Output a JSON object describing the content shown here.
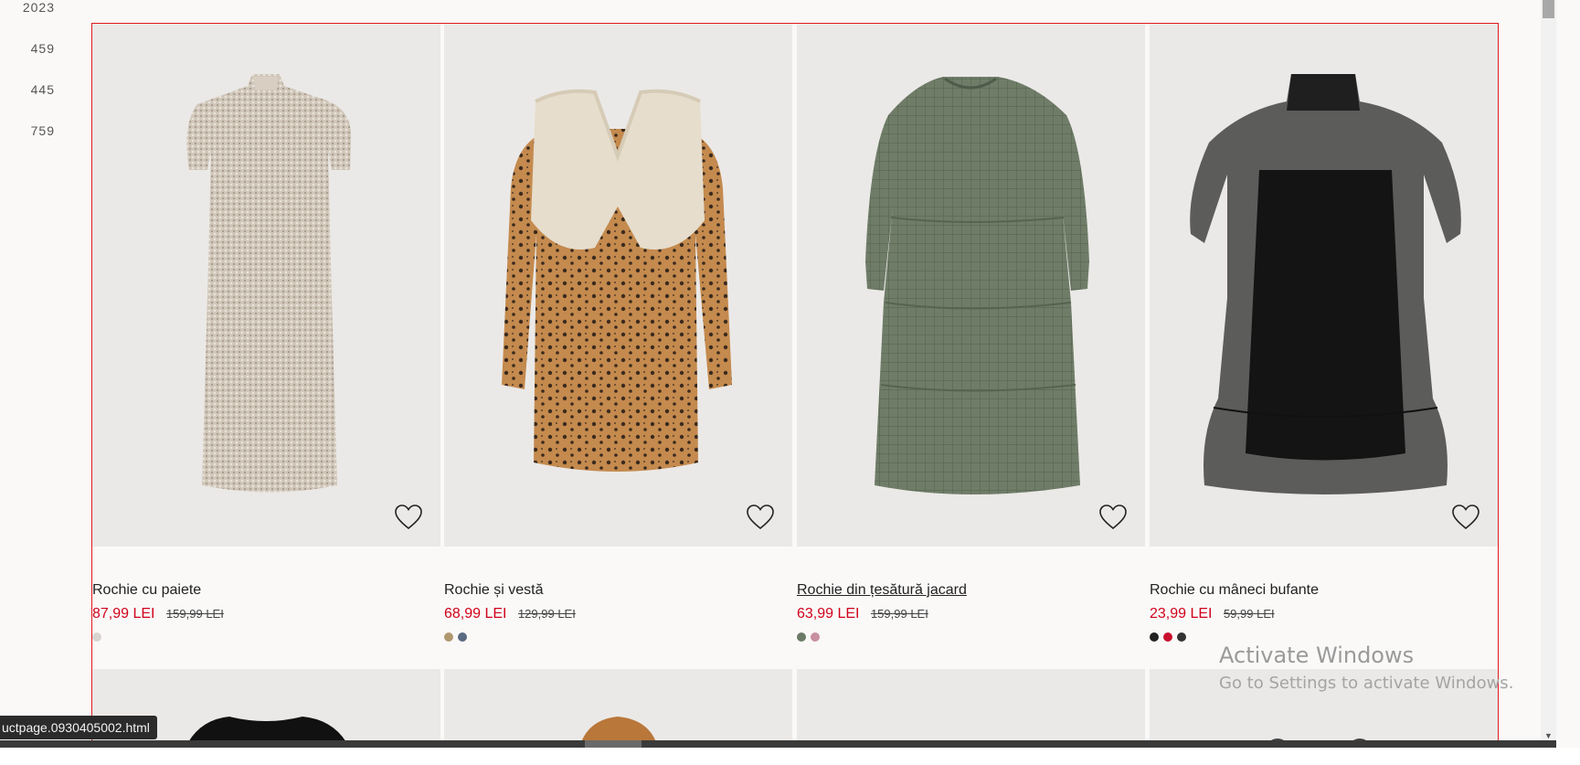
{
  "left_numbers": [
    "2023",
    "459",
    "445",
    "759"
  ],
  "products": [
    {
      "title": "Rochie cu paiete",
      "price": "87,99 LEI",
      "old_price": "159,99 LEI",
      "favorite_icon": "heart-outline-icon",
      "swatches": [
        "#d8d4d0"
      ],
      "hovered": false
    },
    {
      "title": "Rochie și vestă",
      "price": "68,99 LEI",
      "old_price": "129,99 LEI",
      "favorite_icon": "heart-outline-icon",
      "swatches": [
        "#b09870",
        "#5a6a80"
      ],
      "hovered": false
    },
    {
      "title": "Rochie din țesătură jacard",
      "price": "63,99 LEI",
      "old_price": "159,99 LEI",
      "favorite_icon": "heart-outline-icon",
      "swatches": [
        "#6a7a66",
        "#c890a0"
      ],
      "hovered": true
    },
    {
      "title": "Rochie cu mâneci bufante",
      "price": "23,99 LEI",
      "old_price": "59,99 LEI",
      "favorite_icon": "heart-outline-icon",
      "swatches": [
        "#222222",
        "#c8102e",
        "#333333"
      ],
      "hovered": false
    }
  ],
  "watermark": {
    "line1": "Activate Windows",
    "line2": "Go to Settings to activate Windows."
  },
  "status_bar_url": "uctpage.0930405002.html",
  "colors": {
    "accent_red": "#d0021b",
    "selection_frame": "#e0191f",
    "tile_background": "#ebe9e7"
  }
}
